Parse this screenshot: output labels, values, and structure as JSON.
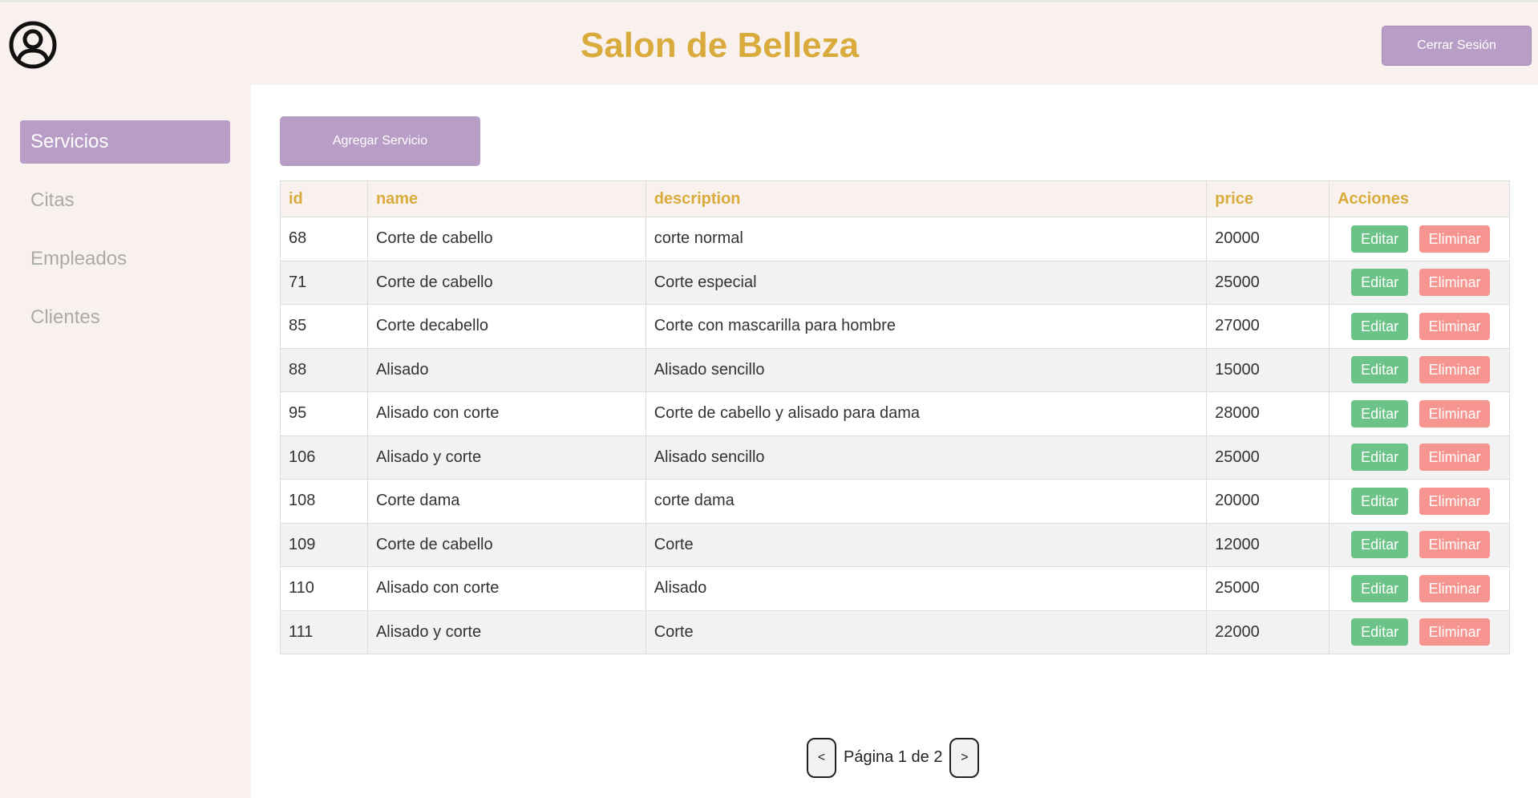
{
  "header": {
    "title": "Salon de Belleza",
    "logout_label": "Cerrar Sesión",
    "title_color": "#d9ab3d",
    "accent_color": "#b89ec6"
  },
  "sidebar": {
    "items": [
      {
        "label": "Servicios",
        "active": true
      },
      {
        "label": "Citas",
        "active": false
      },
      {
        "label": "Empleados",
        "active": false
      },
      {
        "label": "Clientes",
        "active": false
      }
    ]
  },
  "main": {
    "add_button_label": "Agregar Servicio",
    "table": {
      "headers": [
        "id",
        "name",
        "description",
        "price",
        "Acciones"
      ],
      "edit_label": "Editar",
      "delete_label": "Eliminar",
      "rows": [
        {
          "id": "68",
          "name": "Corte de cabello",
          "description": "corte normal",
          "price": "20000"
        },
        {
          "id": "71",
          "name": "Corte de cabello",
          "description": "Corte especial",
          "price": "25000"
        },
        {
          "id": "85",
          "name": "Corte decabello",
          "description": "Corte con mascarilla para hombre",
          "price": "27000"
        },
        {
          "id": "88",
          "name": "Alisado",
          "description": "Alisado sencillo",
          "price": "15000"
        },
        {
          "id": "95",
          "name": "Alisado con corte",
          "description": "Corte de cabello y alisado para dama",
          "price": "28000"
        },
        {
          "id": "106",
          "name": "Alisado y corte",
          "description": "Alisado sencillo",
          "price": "25000"
        },
        {
          "id": "108",
          "name": "Corte dama",
          "description": "corte dama",
          "price": "20000"
        },
        {
          "id": "109",
          "name": "Corte de cabello",
          "description": "Corte",
          "price": "12000"
        },
        {
          "id": "110",
          "name": "Alisado con corte",
          "description": "Alisado",
          "price": "25000"
        },
        {
          "id": "111",
          "name": "Alisado y corte",
          "description": "Corte",
          "price": "22000"
        }
      ]
    },
    "pagination": {
      "prev_label": "<",
      "next_label": ">",
      "page_label": "Página 1 de 2"
    }
  },
  "icons": {
    "user": "user-circle-icon"
  }
}
